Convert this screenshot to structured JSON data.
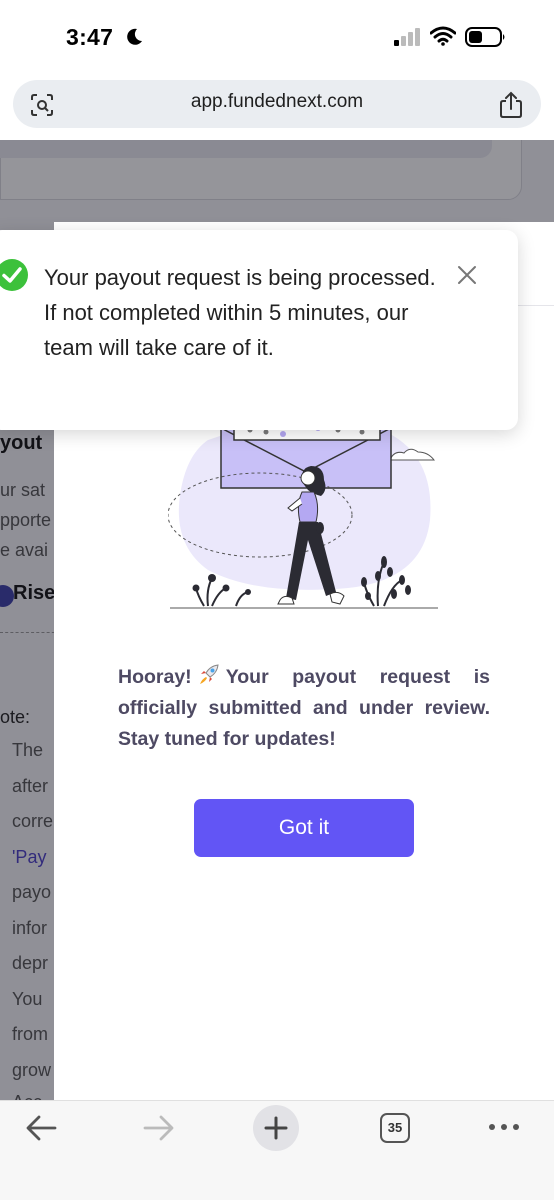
{
  "status_bar": {
    "time": "3:47"
  },
  "url_bar": {
    "url": "app.fundednext.com"
  },
  "background_page": {
    "heading_fragment": "yout",
    "text_fragments": [
      "ur sat",
      "pporte",
      "e avai"
    ],
    "rise_label": "Rise",
    "note_label": "ote:",
    "note_fragments": [
      "The",
      "after",
      "corre",
      "'Pay",
      "payo",
      "infor",
      "depr",
      "You",
      "from",
      "grow",
      "Acc"
    ]
  },
  "toast": {
    "message": "Your payout request is being processed. If not completed within 5 minutes, our team will take care of it."
  },
  "modal": {
    "message_before": "Hooray!",
    "message_after": "Your payout request is officially submitted and under review. Stay tuned for updates!",
    "button_label": "Got it"
  },
  "toolbar": {
    "tab_count": "35"
  },
  "colors": {
    "accent": "#6255f5",
    "success": "#3cc13b",
    "message_text": "#4e4a63"
  },
  "icons": [
    "moon-icon",
    "signal-icon",
    "wifi-icon",
    "battery-icon",
    "site-info-icon",
    "share-icon",
    "check-icon",
    "close-icon",
    "rocket-icon",
    "back-icon",
    "forward-icon",
    "plus-icon",
    "more-icon"
  ]
}
